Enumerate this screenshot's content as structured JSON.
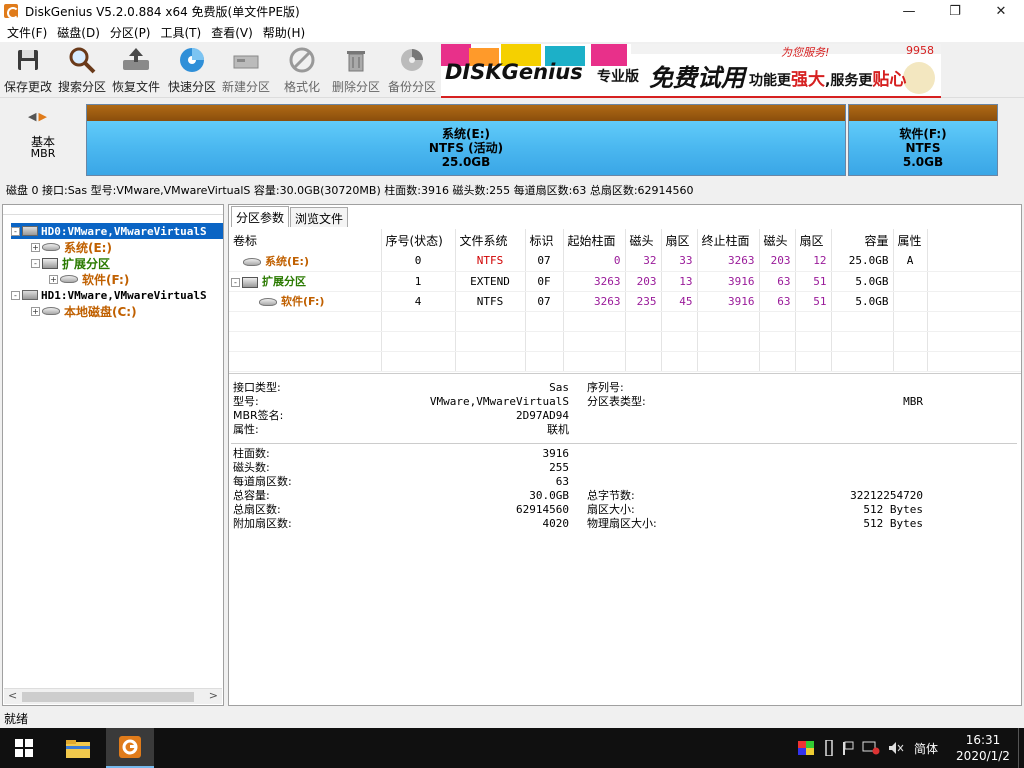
{
  "window": {
    "title": "DiskGenius V5.2.0.884 x64 免费版(单文件PE版)",
    "minimize": "—",
    "maximize": "❐",
    "close": "✕"
  },
  "menu": [
    "文件(F)",
    "磁盘(D)",
    "分区(P)",
    "工具(T)",
    "查看(V)",
    "帮助(H)"
  ],
  "toolbar": [
    {
      "label": "保存更改",
      "icon": "save-icon",
      "enabled": true
    },
    {
      "label": "搜索分区",
      "icon": "search-icon",
      "enabled": true
    },
    {
      "label": "恢复文件",
      "icon": "restore-icon",
      "enabled": true
    },
    {
      "label": "快速分区",
      "icon": "quick-partition-icon",
      "enabled": true
    },
    {
      "label": "新建分区",
      "icon": "new-partition-icon",
      "enabled": false
    },
    {
      "label": "格式化",
      "icon": "format-icon",
      "enabled": false
    },
    {
      "label": "删除分区",
      "icon": "delete-icon",
      "enabled": false
    },
    {
      "label": "备份分区",
      "icon": "backup-icon",
      "enabled": false
    }
  ],
  "banner": {
    "brand": "DISKGenius",
    "edition": "专业版",
    "free_trial": "免费试用",
    "slogan_a": "功能更",
    "slogan_b": "强大",
    "slogan_c": ",服务更",
    "slogan_d": "贴心",
    "top_text": "为您服务!",
    "digits": "9958"
  },
  "diskmap": {
    "nav_left": "◀",
    "nav_right": "▶",
    "disk_type_line1": "基本",
    "disk_type_line2": "MBR",
    "partitions": [
      {
        "name": "系统(E:)",
        "fs": "NTFS (活动)",
        "size": "25.0GB"
      },
      {
        "name": "软件(F:)",
        "fs": "NTFS",
        "size": "5.0GB"
      }
    ]
  },
  "diskinfo": "磁盘 0 接口:Sas  型号:VMware,VMwareVirtualS  容量:30.0GB(30720MB)  柱面数:3916  磁头数:255  每道扇区数:63  总扇区数:62914560",
  "tree": [
    {
      "label": "HD0:VMware,VMwareVirtualS",
      "toggle": "-",
      "level": 0,
      "type": "disk",
      "selected": true
    },
    {
      "label": "系统(E:)",
      "toggle": "+",
      "level": 1,
      "type": "volume",
      "color": "orange"
    },
    {
      "label": "扩展分区",
      "toggle": "-",
      "level": 1,
      "type": "extended",
      "color": "green"
    },
    {
      "label": "软件(F:)",
      "toggle": "+",
      "level": 2,
      "type": "volume",
      "color": "orange"
    },
    {
      "label": "HD1:VMware,VMwareVirtualS",
      "toggle": "-",
      "level": 0,
      "type": "disk",
      "selected": false
    },
    {
      "label": "本地磁盘(C:)",
      "toggle": "+",
      "level": 1,
      "type": "volume",
      "color": "orange"
    }
  ],
  "tree_scroll": {
    "left": "<",
    "right": ">"
  },
  "tabs": [
    "分区参数",
    "浏览文件"
  ],
  "table": {
    "headers": [
      "卷标",
      "序号(状态)",
      "文件系统",
      "标识",
      "起始柱面",
      "磁头",
      "扇区",
      "终止柱面",
      "磁头",
      "扇区",
      "容量",
      "属性"
    ],
    "rows": [
      {
        "label": "系统(E:)",
        "seq": "0",
        "fs": "NTFS",
        "id": "07",
        "start_cyl": "0",
        "start_head": "32",
        "start_sec": "33",
        "end_cyl": "3263",
        "end_head": "203",
        "end_sec": "12",
        "capacity": "25.0GB",
        "attr": "A"
      },
      {
        "label": "扩展分区",
        "seq": "1",
        "fs": "EXTEND",
        "id": "0F",
        "start_cyl": "3263",
        "start_head": "203",
        "start_sec": "13",
        "end_cyl": "3916",
        "end_head": "63",
        "end_sec": "51",
        "capacity": "5.0GB",
        "attr": ""
      },
      {
        "label": "软件(F:)",
        "seq": "4",
        "fs": "NTFS",
        "id": "07",
        "start_cyl": "3263",
        "start_head": "235",
        "start_sec": "45",
        "end_cyl": "3916",
        "end_head": "63",
        "end_sec": "51",
        "capacity": "5.0GB",
        "attr": ""
      }
    ]
  },
  "details": {
    "interface_label": "接口类型:",
    "interface": "Sas",
    "model_label": "型号:",
    "model": "VMware,VMwareVirtualS",
    "mbr_sig_label": "MBR签名:",
    "mbr_sig": "2D97AD94",
    "attr_label": "属性:",
    "attr": "联机",
    "serial_label": "序列号:",
    "serial": "",
    "ptable_type_label": "分区表类型:",
    "ptable_type": "MBR",
    "cylinders_label": "柱面数:",
    "cylinders": "3916",
    "heads_label": "磁头数:",
    "heads": "255",
    "spt_label": "每道扇区数:",
    "spt": "63",
    "total_cap_label": "总容量:",
    "total_cap": "30.0GB",
    "total_sec_label": "总扇区数:",
    "total_sec": "62914560",
    "extra_sec_label": "附加扇区数:",
    "extra_sec": "4020",
    "total_bytes_label": "总字节数:",
    "total_bytes": "32212254720",
    "sector_size_label": "扇区大小:",
    "sector_size": "512 Bytes",
    "phys_sector_label": "物理扇区大小:",
    "phys_sector": "512 Bytes"
  },
  "status": "就绪",
  "taskbar": {
    "ime": "简体",
    "time": "16:31",
    "date": "2020/1/2"
  }
}
